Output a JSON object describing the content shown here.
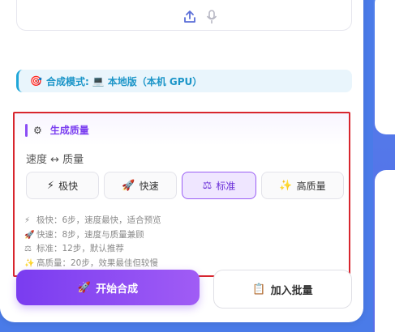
{
  "toolbar": {
    "upload_icon": "upload-icon",
    "mic_icon": "microphone-icon"
  },
  "mode": {
    "icon": "🎯",
    "label": "合成模式:",
    "pc_icon": "💻",
    "value": "本地版（本机 GPU）"
  },
  "quality": {
    "gear_icon": "⚙",
    "title": "生成质量",
    "subtitle": "速度 ↔ 质量",
    "options": [
      {
        "icon": "⚡",
        "label": "极快",
        "selected": false
      },
      {
        "icon": "🚀",
        "label": "快速",
        "selected": false
      },
      {
        "icon": "⚖",
        "label": "标准",
        "selected": true
      },
      {
        "icon": "✨",
        "label": "高质量",
        "selected": false
      }
    ],
    "notes": [
      {
        "icon": "⚡",
        "text": "极快：6步，速度最快，适合预览"
      },
      {
        "icon": "🚀",
        "text": "快速：8步，速度与质量兼顾"
      },
      {
        "icon": "⚖",
        "text": "标准：12步，默认推荐"
      },
      {
        "icon": "✨",
        "text": "高质量：20步，效果最佳但较慢"
      }
    ]
  },
  "actions": {
    "start_icon": "🚀",
    "start_label": "开始合成",
    "batch_icon": "📋",
    "batch_label": "加入批量"
  },
  "colors": {
    "accent": "#7b3ff0",
    "highlight_border": "#d8262e",
    "mode_text": "#1b95c8",
    "background": "#4a7be8"
  }
}
